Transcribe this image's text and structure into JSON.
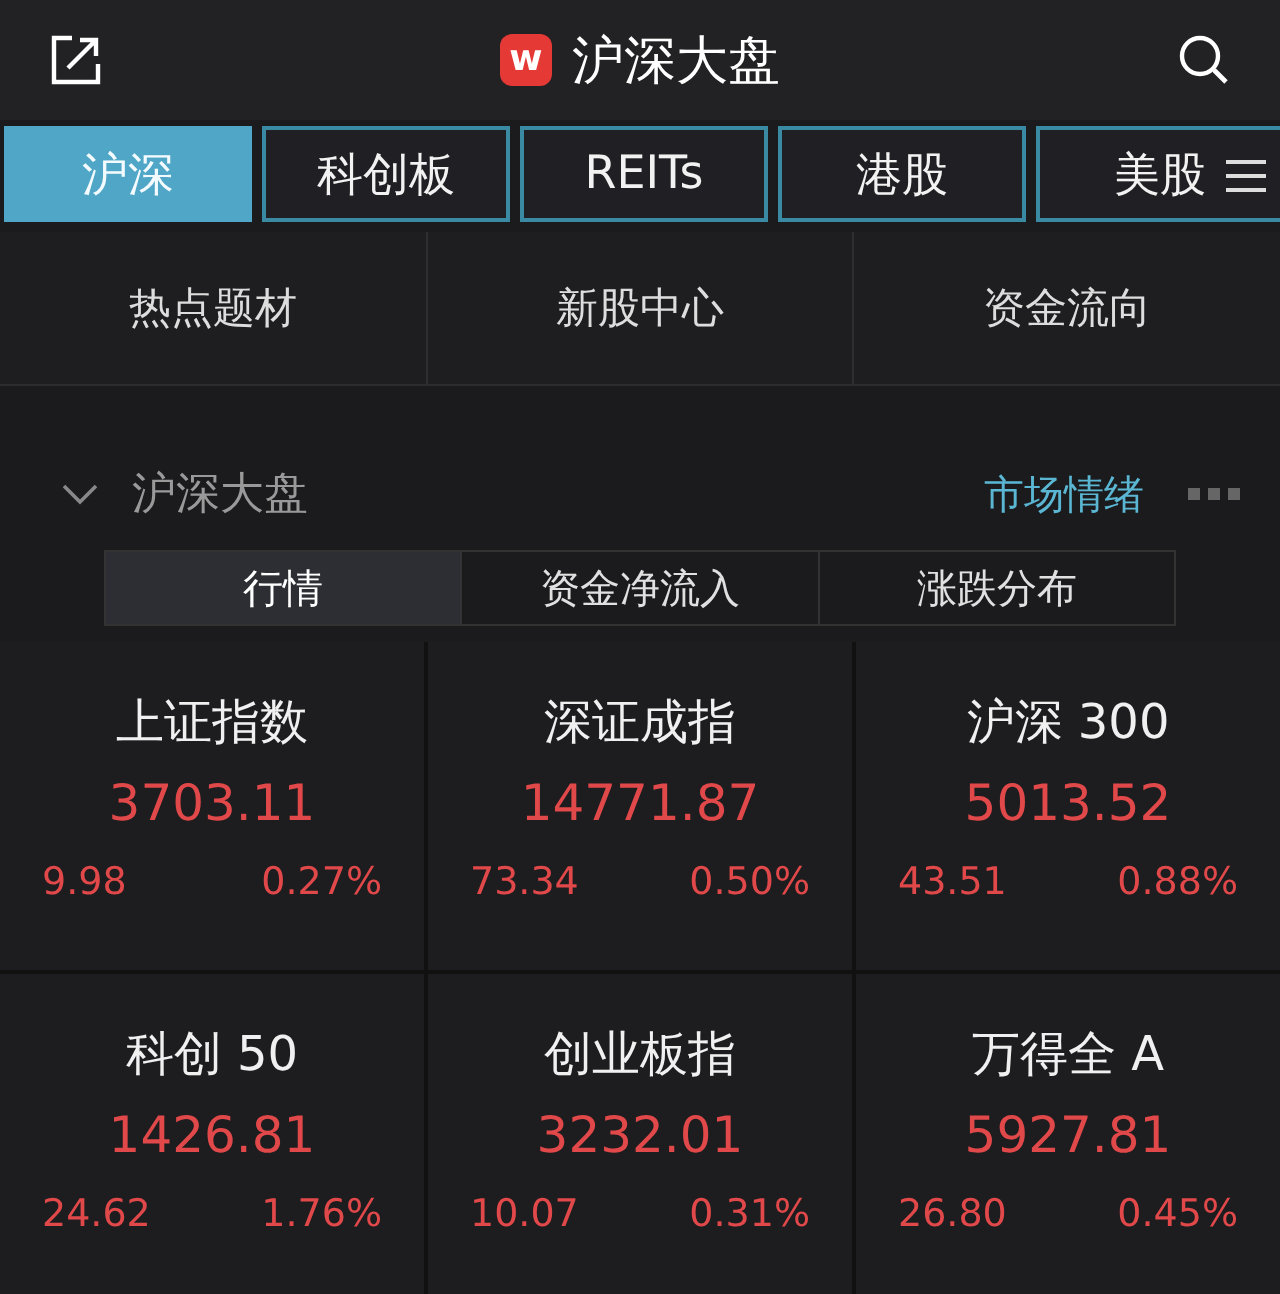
{
  "header": {
    "logo": "w",
    "title": "沪深大盘"
  },
  "tabs": [
    {
      "label": "沪深",
      "selected": true
    },
    {
      "label": "科创板",
      "selected": false
    },
    {
      "label": "REITs",
      "selected": false
    },
    {
      "label": "港股",
      "selected": false
    },
    {
      "label": "美股",
      "selected": false
    }
  ],
  "shortcuts": [
    "热点题材",
    "新股中心",
    "资金流向"
  ],
  "section": {
    "title": "沪深大盘",
    "expanded": true,
    "link": "市场情绪"
  },
  "subtabs": [
    {
      "label": "行情",
      "selected": true
    },
    {
      "label": "资金净流入",
      "selected": false
    },
    {
      "label": "涨跌分布",
      "selected": false
    }
  ],
  "indices": [
    {
      "name": "上证指数",
      "value": "3703.11",
      "change": "9.98",
      "percent": "0.27%",
      "up": true
    },
    {
      "name": "深证成指",
      "value": "14771.87",
      "change": "73.34",
      "percent": "0.50%",
      "up": true
    },
    {
      "name": "沪深 300",
      "value": "5013.52",
      "change": "43.51",
      "percent": "0.88%",
      "up": true
    },
    {
      "name": "科创 50",
      "value": "1426.81",
      "change": "24.62",
      "percent": "1.76%",
      "up": true
    },
    {
      "name": "创业板指",
      "value": "3232.01",
      "change": "10.07",
      "percent": "0.31%",
      "up": true
    },
    {
      "name": "万得全 A",
      "value": "5927.81",
      "change": "26.80",
      "percent": "0.45%",
      "up": true
    }
  ]
}
